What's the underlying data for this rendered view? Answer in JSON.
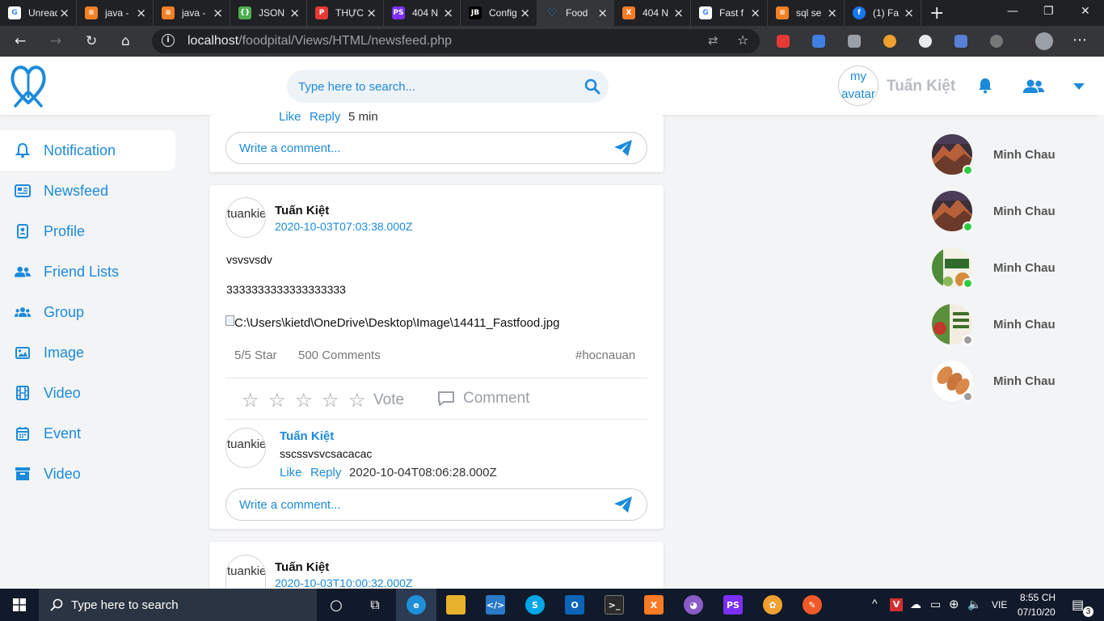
{
  "browser": {
    "tabs": [
      {
        "title": "Unread",
        "fav": "google",
        "color": "#ffffff"
      },
      {
        "title": "java -",
        "fav": "stackoverflow",
        "color": "#f48024"
      },
      {
        "title": "java -",
        "fav": "stackoverflow",
        "color": "#f48024"
      },
      {
        "title": "JSON",
        "fav": "json",
        "color": "#4caf50"
      },
      {
        "title": "THỰC",
        "fav": "pdf",
        "color": "#e53935"
      },
      {
        "title": "404 N",
        "fav": "phpstorm",
        "color": "#7b2ff7"
      },
      {
        "title": "Config",
        "fav": "jetbrains",
        "color": "#000000"
      },
      {
        "title": "Food",
        "fav": "foodpital",
        "color": "#1c8adb",
        "active": true
      },
      {
        "title": "404 N",
        "fav": "xampp",
        "color": "#fb7a24"
      },
      {
        "title": "Fast f",
        "fav": "google",
        "color": "#ffffff"
      },
      {
        "title": "sql se",
        "fav": "stackoverflow",
        "color": "#f48024"
      },
      {
        "title": "(1) Fa",
        "fav": "facebook",
        "color": "#1877f2"
      }
    ],
    "url_host": "localhost",
    "url_path": "/foodpital/Views/HTML/newsfeed.php"
  },
  "header": {
    "search_placeholder": "Type here to search...",
    "avatar_alt": "my avatar",
    "user_name": "Tuấn Kiệt"
  },
  "sidebar": {
    "items": [
      {
        "label": "Notification",
        "icon": "bell-icon",
        "active": true
      },
      {
        "label": "Newsfeed",
        "icon": "newspaper-icon"
      },
      {
        "label": "Profile",
        "icon": "id-badge-icon"
      },
      {
        "label": "Friend Lists",
        "icon": "user-friends-icon"
      },
      {
        "label": "Group",
        "icon": "users-icon"
      },
      {
        "label": "Image",
        "icon": "image-icon"
      },
      {
        "label": "Video",
        "icon": "film-icon"
      },
      {
        "label": "Event",
        "icon": "calendar-icon"
      },
      {
        "label": "Video",
        "icon": "archive-icon"
      }
    ]
  },
  "feed": {
    "top_card": {
      "like": "Like",
      "reply": "Reply",
      "time": "5 min",
      "comment_placeholder": "Write a comment..."
    },
    "post": {
      "avatar_alt": "tuankiet",
      "author": "Tuấn Kiệt",
      "timestamp": "2020-10-03T07:03:38.000Z",
      "text1": "vsvsvsdv",
      "text2": "3333333333333333333",
      "image_alt": "C:\\Users\\kietd\\OneDrive\\Desktop\\Image\\14411_Fastfood.jpg",
      "stars": "5/5 Star",
      "comments_count": "500 Comments",
      "hashtag": "#hocnauan",
      "vote_label": "Vote",
      "comment_label": "Comment",
      "comment": {
        "avatar_alt": "tuankiet",
        "author": "Tuấn Kiệt",
        "text": "sscssvsvcsacacac",
        "like": "Like",
        "reply": "Reply",
        "time": "2020-10-04T08:06:28.000Z"
      },
      "comment_placeholder": "Write a comment..."
    },
    "next_post": {
      "avatar_alt": "tuankiet",
      "author": "Tuấn Kiệt",
      "timestamp": "2020-10-03T10:00:32.000Z"
    }
  },
  "friends": [
    {
      "name": "Minh Chau",
      "online": true,
      "avatar": "mountain"
    },
    {
      "name": "Minh Chau",
      "online": true,
      "avatar": "mountain"
    },
    {
      "name": "Minh Chau",
      "online": true,
      "avatar": "diet-plan"
    },
    {
      "name": "Minh Chau",
      "online": false,
      "avatar": "custom-food-plan"
    },
    {
      "name": "Minh Chau",
      "online": false,
      "avatar": "food-rolls"
    }
  ],
  "colors": {
    "accent": "#1c8adb",
    "online": "#2ecc40",
    "offline": "#9e9e9e"
  },
  "taskbar": {
    "search_placeholder": "Type here to search",
    "language": "VIE",
    "time": "8:55 CH",
    "date": "07/10/20",
    "notifications": "3"
  }
}
